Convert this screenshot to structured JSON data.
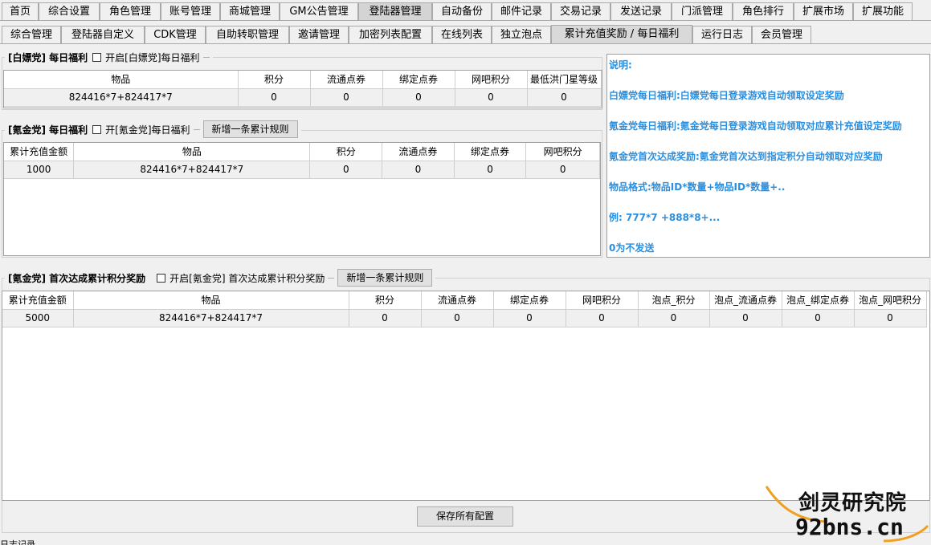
{
  "main_tabs": [
    "首页",
    "综合设置",
    "角色管理",
    "账号管理",
    "商城管理",
    "GM公告管理",
    "登陆器管理",
    "自动备份",
    "邮件记录",
    "交易记录",
    "发送记录",
    "门派管理",
    "角色排行",
    "扩展市场",
    "扩展功能"
  ],
  "main_active": "登陆器管理",
  "sub_tabs": [
    "综合管理",
    "登陆器自定义",
    "CDK管理",
    "自助转职管理",
    "邀请管理",
    "加密列表配置",
    "在线列表",
    "独立泡点",
    "累计充值奖励 / 每日福利",
    "运行日志",
    "会员管理"
  ],
  "sub_active": "累计充值奖励 / 每日福利",
  "section1": {
    "title": "[白嫖党] 每日福利",
    "checkbox": "开启[白嫖党]每日福利",
    "columns": [
      "物品",
      "积分",
      "流通点券",
      "绑定点券",
      "网吧积分",
      "最低洪门星等级"
    ],
    "rows": [
      [
        "824416*7+824417*7",
        "0",
        "0",
        "0",
        "0",
        "0"
      ]
    ]
  },
  "section2": {
    "title": "[氪金党] 每日福利",
    "checkbox": "开[氪金党]每日福利",
    "button": "新增一条累计规则",
    "columns": [
      "累计充值金额",
      "物品",
      "积分",
      "流通点券",
      "绑定点券",
      "网吧积分"
    ],
    "rows": [
      [
        "1000",
        "824416*7+824417*7",
        "0",
        "0",
        "0",
        "0"
      ]
    ]
  },
  "section3": {
    "title": "[氪金党] 首次达成累计积分奖励",
    "checkbox": "开启[氪金党] 首次达成累计积分奖励",
    "button": "新增一条累计规则",
    "columns": [
      "累计充值金额",
      "物品",
      "积分",
      "流通点券",
      "绑定点券",
      "网吧积分",
      "泡点_积分",
      "泡点_流通点券",
      "泡点_绑定点券",
      "泡点_网吧积分"
    ],
    "rows": [
      [
        "5000",
        "824416*7+824417*7",
        "0",
        "0",
        "0",
        "0",
        "0",
        "0",
        "0",
        "0"
      ]
    ]
  },
  "notes": [
    "说明:",
    "白嫖党每日福利:白嫖党每日登录游戏自动领取设定奖励",
    "氪金党每日福利:氪金党每日登录游戏自动领取对应累计充值设定奖励",
    "氪金党首次达成奖励:氪金党首次达到指定积分自动领取对应奖励",
    "物品格式:物品ID*数量+物品ID*数量+..",
    "例: 777*7 +888*8+...",
    "0为不发送"
  ],
  "save_button": "保存所有配置",
  "status_text": "日志记录",
  "watermark": {
    "cn": "剑灵研究院",
    "en": "92bns.cn"
  },
  "colors": {
    "note_text": "#2b8fe0",
    "active_tab": "#d4d4d4"
  }
}
